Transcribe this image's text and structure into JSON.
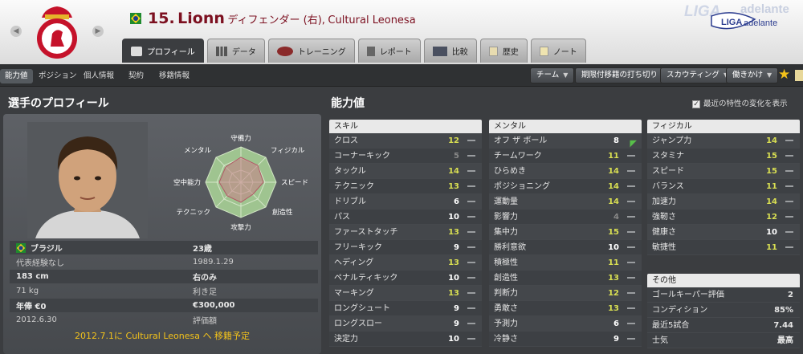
{
  "header": {
    "number": "15.",
    "name": "Lionn",
    "position": "ディフェンダー (右),",
    "club": "Cultural Leonesa",
    "league": "LIGA adelante"
  },
  "tabs": [
    "プロフィール",
    "データ",
    "トレーニング",
    "レポート",
    "比較",
    "歴史",
    "ノート"
  ],
  "subnav": {
    "items": [
      "能力値",
      "ポジション",
      "個人情報",
      "契約",
      "移籍情報"
    ],
    "buttons": [
      "チーム",
      "期限付移籍の打ち切り",
      "スカウティング",
      "働きかけ"
    ]
  },
  "sections": {
    "profile": "選手のプロフィール",
    "attributes": "能力値",
    "checkbox": "最近の特性の変化を表示"
  },
  "radar": {
    "labels": [
      "守備力",
      "フィジカル",
      "スピード",
      "創造性",
      "攻撃力",
      "テクニック",
      "空中能力",
      "メンタル"
    ]
  },
  "info": {
    "nation": "ブラジル",
    "age": "23歳",
    "caps": "代表経験なし",
    "birth": "1989.1.29",
    "height": "183 cm",
    "foot": "右のみ",
    "weight": "71 kg",
    "foot_label": "利き足",
    "wage": "年俸 €0",
    "value": "€300,000",
    "contract": "2012.6.30",
    "value_label": "評価額",
    "transfer": "2012.7.1に Cultural Leonesa へ 移籍予定"
  },
  "skills": {
    "title": "スキル",
    "rows": [
      [
        "クロス",
        "12"
      ],
      [
        "コーナーキック",
        "5"
      ],
      [
        "タックル",
        "14"
      ],
      [
        "テクニック",
        "13"
      ],
      [
        "ドリブル",
        "6"
      ],
      [
        "パス",
        "10"
      ],
      [
        "ファーストタッチ",
        "13"
      ],
      [
        "フリーキック",
        "9"
      ],
      [
        "ヘディング",
        "13"
      ],
      [
        "ペナルティキック",
        "10"
      ],
      [
        "マーキング",
        "13"
      ],
      [
        "ロングシュート",
        "9"
      ],
      [
        "ロングスロー",
        "9"
      ],
      [
        "決定力",
        "10"
      ]
    ]
  },
  "mental": {
    "title": "メンタル",
    "rows": [
      [
        "オフ ザ ボール",
        "8"
      ],
      [
        "チームワーク",
        "11"
      ],
      [
        "ひらめき",
        "14"
      ],
      [
        "ポジショニング",
        "14"
      ],
      [
        "運動量",
        "14"
      ],
      [
        "影響力",
        "4"
      ],
      [
        "集中力",
        "15"
      ],
      [
        "勝利意欲",
        "10"
      ],
      [
        "積極性",
        "11"
      ],
      [
        "創造性",
        "13"
      ],
      [
        "判断力",
        "12"
      ],
      [
        "勇敢さ",
        "13"
      ],
      [
        "予測力",
        "6"
      ],
      [
        "冷静さ",
        "9"
      ]
    ]
  },
  "physical": {
    "title": "フィジカル",
    "rows": [
      [
        "ジャンプ力",
        "14"
      ],
      [
        "スタミナ",
        "15"
      ],
      [
        "スピード",
        "15"
      ],
      [
        "バランス",
        "11"
      ],
      [
        "加速力",
        "14"
      ],
      [
        "強靭さ",
        "12"
      ],
      [
        "健康さ",
        "10"
      ],
      [
        "敏捷性",
        "11"
      ]
    ]
  },
  "other": {
    "title": "その他",
    "rows": [
      [
        "ゴールキーパー評価",
        "2"
      ],
      [
        "コンディション",
        "85%"
      ],
      [
        "最近5試合",
        "7.44"
      ],
      [
        "士気",
        "最高"
      ]
    ]
  }
}
